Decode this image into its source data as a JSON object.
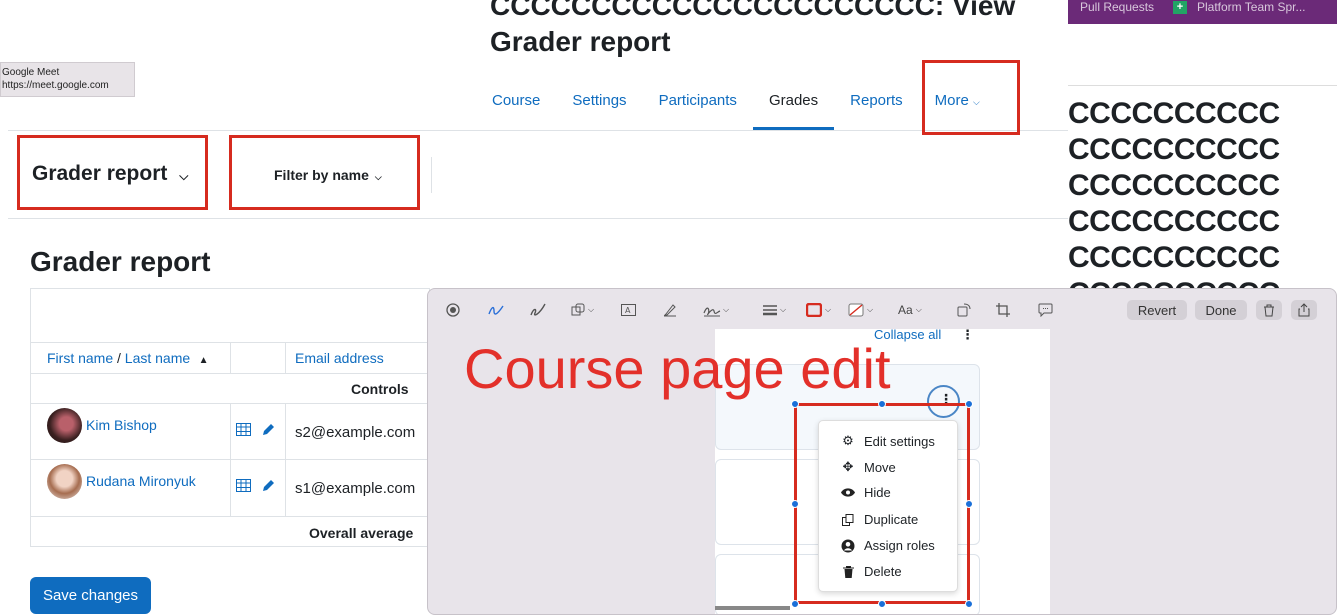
{
  "page": {
    "title_line1": "CCCCCCCCCCCCCCCCCCCCCC: View",
    "title_line2": "Grader report"
  },
  "nav": {
    "tabs": [
      "Course",
      "Settings",
      "Participants",
      "Grades",
      "Reports",
      "More"
    ],
    "active": "Grades"
  },
  "tooltip": {
    "line1": "Google Meet",
    "line2": "https://meet.google.com"
  },
  "toolbar": {
    "report_select": "Grader report",
    "filter_label": "Filter by name"
  },
  "heading": "Grader report",
  "table": {
    "col_firstname": "First name",
    "col_sep": " / ",
    "col_lastname": "Last name",
    "col_email": "Email address",
    "controls_label": "Controls",
    "overall_label": "Overall average",
    "rows": [
      {
        "name": "Kim Bishop",
        "email": "s2@example.com"
      },
      {
        "name": "Rudana Mironyuk",
        "email": "s1@example.com"
      }
    ]
  },
  "save_button": "Save changes",
  "background_window": {
    "tabs": [
      "Pull Requests",
      "Platform Team Spr..."
    ],
    "repeated_text": "CCCCCCCCCC"
  },
  "markup_window": {
    "revert": "Revert",
    "done": "Done",
    "font_tool": "Aa",
    "annotation_text": "Course page edit",
    "collapse_all": "Collapse all",
    "menu": [
      "Edit settings",
      "Move",
      "Hide",
      "Duplicate",
      "Assign roles",
      "Delete"
    ]
  },
  "colors": {
    "link": "#0f6cbf",
    "annotation_red": "#d62b1f",
    "selection_blue": "#1a6fd8",
    "browser_tab_bar": "#6b2a78"
  }
}
